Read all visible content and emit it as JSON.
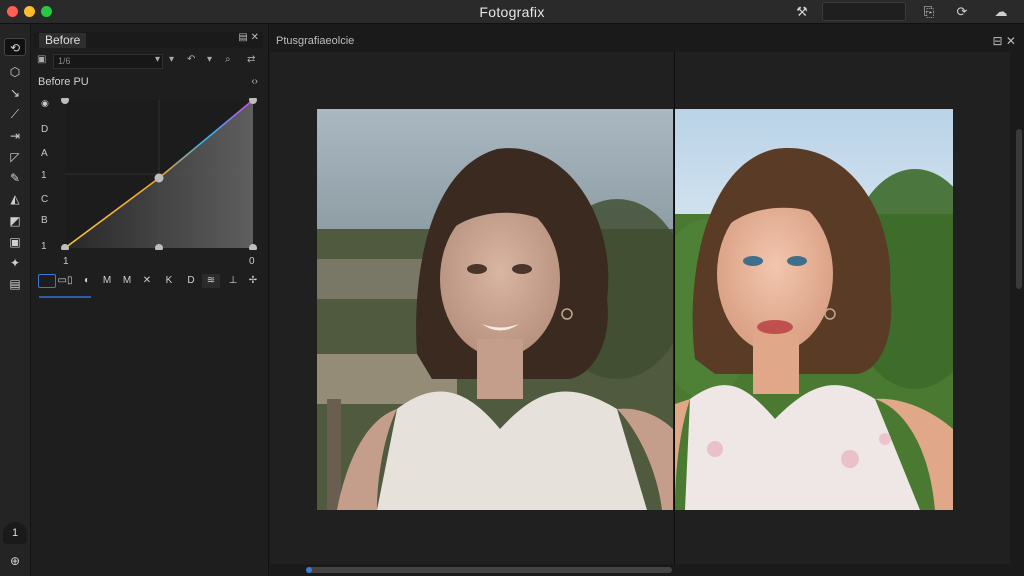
{
  "window": {
    "title": "Fotografix"
  },
  "titlebar": {
    "search_placeholder": "",
    "icons": [
      "tools-icon",
      "share-icon",
      "sync-icon",
      "cloud-icon"
    ]
  },
  "toolbar": {
    "tools": [
      {
        "name": "transform-tool-icon",
        "glyph": "⟲",
        "active": true
      },
      {
        "name": "shape-tool-icon",
        "glyph": "⬡"
      },
      {
        "name": "select-tool-icon",
        "glyph": "↘"
      },
      {
        "name": "line-tool-icon",
        "glyph": "⟋"
      },
      {
        "name": "measure-tool-icon",
        "glyph": "⇥"
      },
      {
        "name": "lasso-tool-icon",
        "glyph": "◸"
      },
      {
        "name": "brush-tool-icon",
        "glyph": "✎"
      },
      {
        "name": "fill-tool-icon",
        "glyph": "◭"
      },
      {
        "name": "eraser-tool-icon",
        "glyph": "◩"
      },
      {
        "name": "image-tool-icon",
        "glyph": "▣"
      },
      {
        "name": "stamp-tool-icon",
        "glyph": "✦"
      },
      {
        "name": "bag-tool-icon",
        "glyph": "▤"
      }
    ],
    "bottom_label": "1"
  },
  "panel": {
    "tab_label": "Before",
    "tab_icons": "▤  ✕",
    "preset_value": "1/6",
    "curve_title": "Before PU",
    "curve_reset": "‹›",
    "channels": [
      "D",
      "A",
      "1",
      "C",
      "B",
      "1"
    ],
    "top_left_marker": "◉",
    "x_axis_left": "1",
    "x_axis_right": "0",
    "curve_tools": [
      "",
      "▭▯",
      "◐",
      "M",
      "M",
      "✕",
      "K",
      "D",
      "≋",
      "⊥",
      "✢"
    ]
  },
  "viewer": {
    "title": "Ptusgrafiaeolcie",
    "icons": "⊟  ✕"
  }
}
